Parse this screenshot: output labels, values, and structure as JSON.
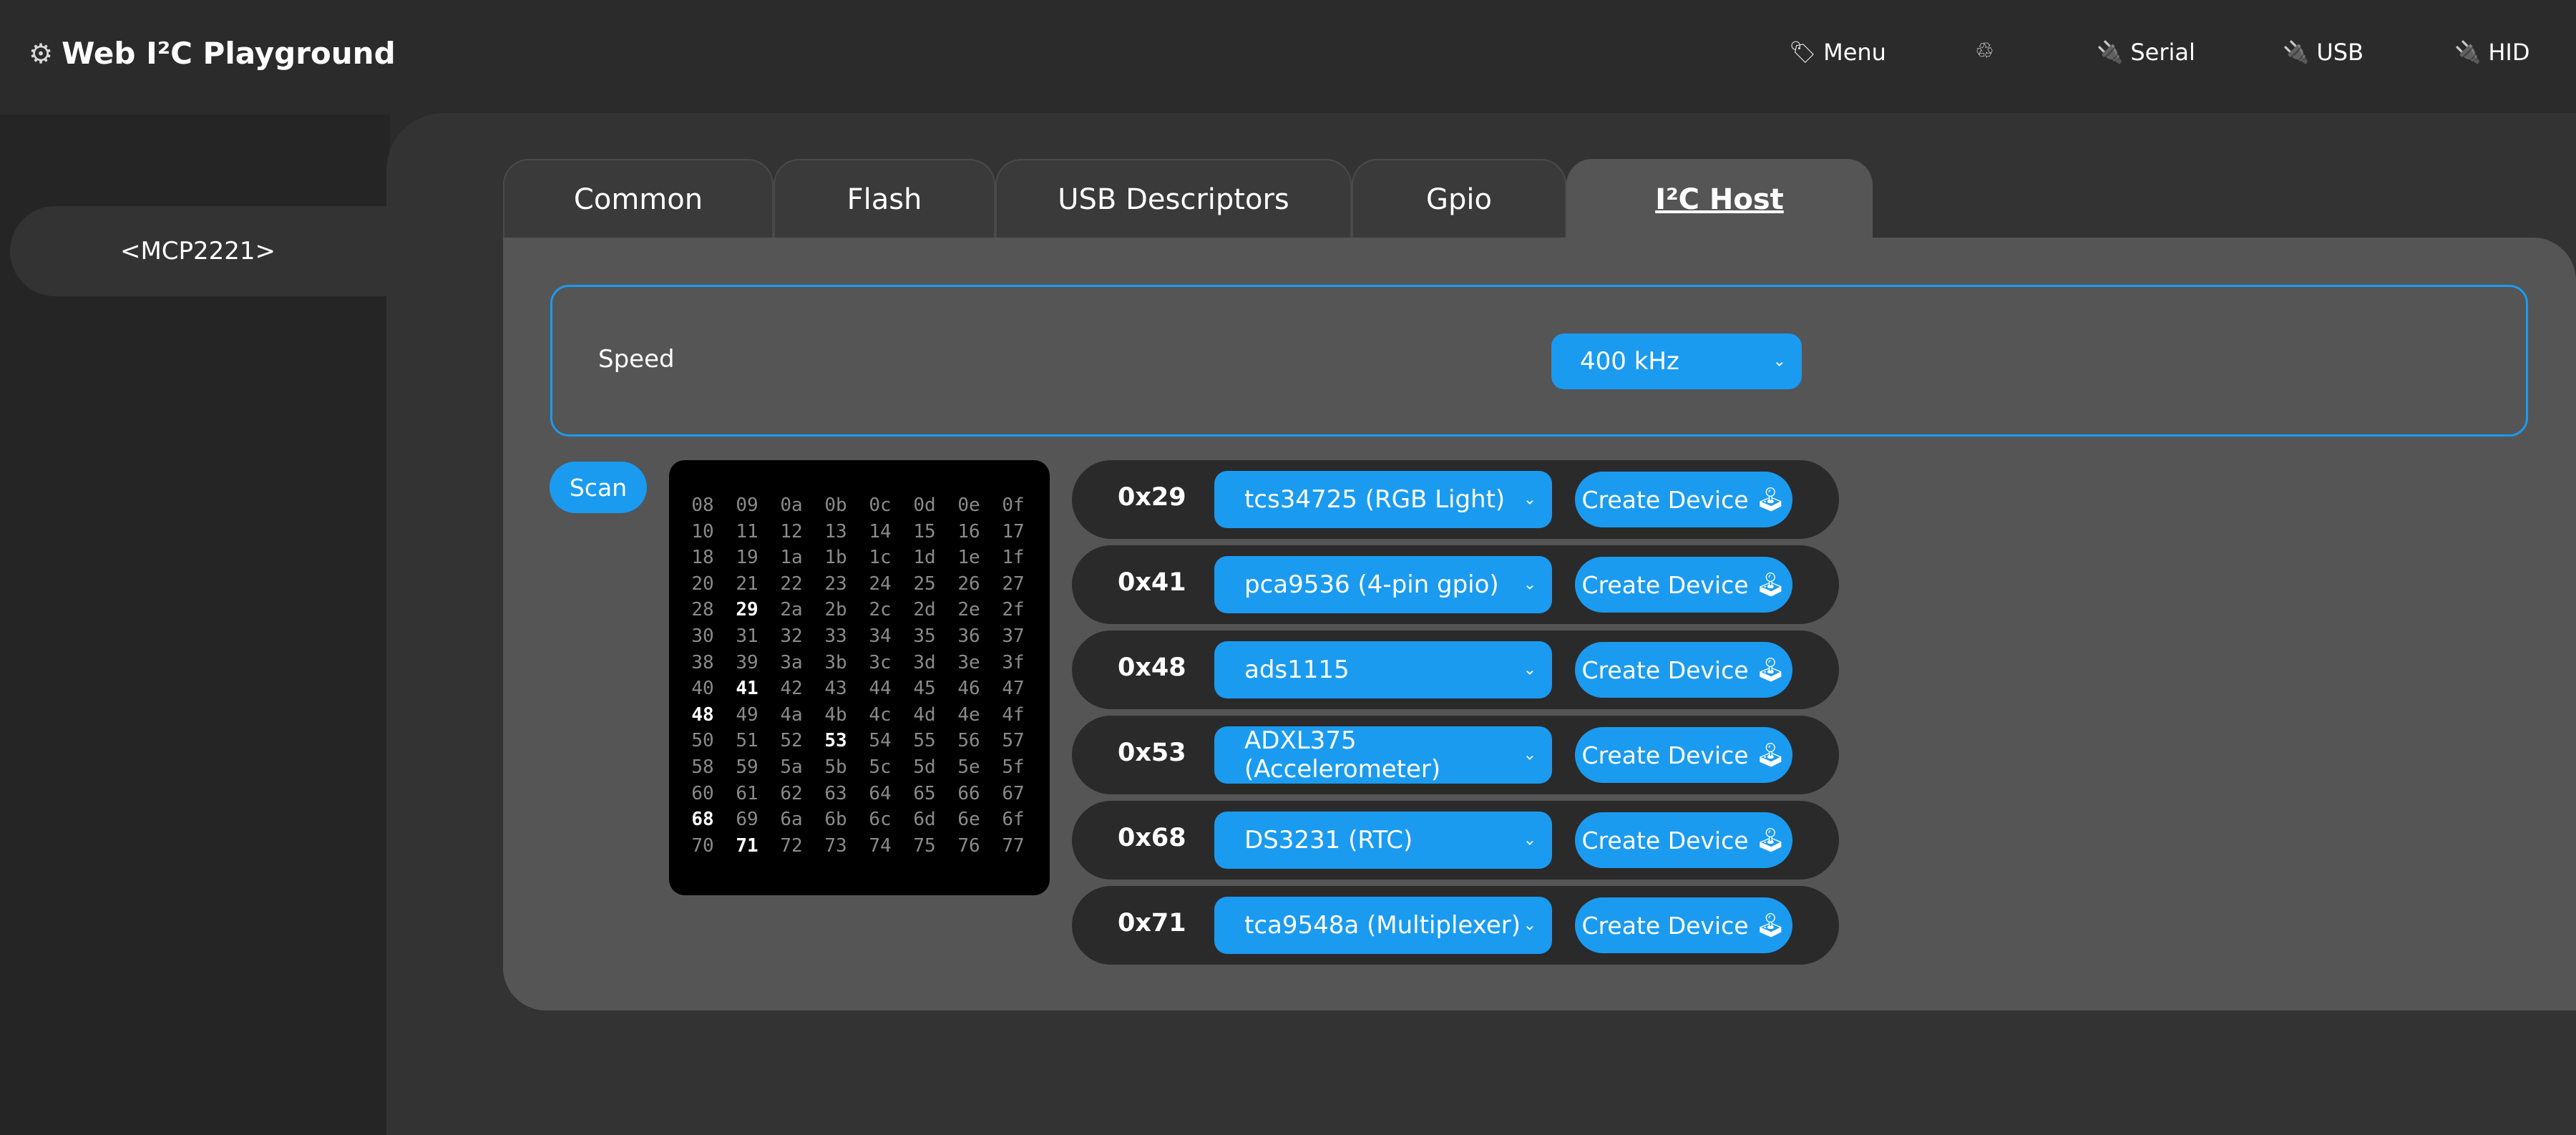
{
  "header": {
    "title": "Web I²C Playground",
    "nav": [
      {
        "icon": "tag-icon",
        "glyph": "🏷",
        "label": "Menu"
      },
      {
        "icon": "recycle-icon",
        "glyph": "♲",
        "label": ""
      },
      {
        "icon": "plug-icon",
        "glyph": "🔌",
        "label": "Serial"
      },
      {
        "icon": "plug-icon",
        "glyph": "🔌",
        "label": "USB"
      },
      {
        "icon": "plug-icon",
        "glyph": "🔌",
        "label": "HID"
      }
    ]
  },
  "sidebar": {
    "device": "<MCP2221>"
  },
  "tabs": [
    "Common",
    "Flash",
    "USB Descriptors",
    "Gpio",
    "I²C Host"
  ],
  "active_tab": "I²C Host",
  "speed": {
    "label": "Speed",
    "value": "400 kHz"
  },
  "scan_label": "Scan",
  "scan_grid": {
    "rows": [
      [
        "08",
        "09",
        "0a",
        "0b",
        "0c",
        "0d",
        "0e",
        "0f"
      ],
      [
        "10",
        "11",
        "12",
        "13",
        "14",
        "15",
        "16",
        "17"
      ],
      [
        "18",
        "19",
        "1a",
        "1b",
        "1c",
        "1d",
        "1e",
        "1f"
      ],
      [
        "20",
        "21",
        "22",
        "23",
        "24",
        "25",
        "26",
        "27"
      ],
      [
        "28",
        "29",
        "2a",
        "2b",
        "2c",
        "2d",
        "2e",
        "2f"
      ],
      [
        "30",
        "31",
        "32",
        "33",
        "34",
        "35",
        "36",
        "37"
      ],
      [
        "38",
        "39",
        "3a",
        "3b",
        "3c",
        "3d",
        "3e",
        "3f"
      ],
      [
        "40",
        "41",
        "42",
        "43",
        "44",
        "45",
        "46",
        "47"
      ],
      [
        "48",
        "49",
        "4a",
        "4b",
        "4c",
        "4d",
        "4e",
        "4f"
      ],
      [
        "50",
        "51",
        "52",
        "53",
        "54",
        "55",
        "56",
        "57"
      ],
      [
        "58",
        "59",
        "5a",
        "5b",
        "5c",
        "5d",
        "5e",
        "5f"
      ],
      [
        "60",
        "61",
        "62",
        "63",
        "64",
        "65",
        "66",
        "67"
      ],
      [
        "68",
        "69",
        "6a",
        "6b",
        "6c",
        "6d",
        "6e",
        "6f"
      ],
      [
        "70",
        "71",
        "72",
        "73",
        "74",
        "75",
        "76",
        "77"
      ]
    ],
    "found": [
      "29",
      "41",
      "48",
      "53",
      "68",
      "71"
    ]
  },
  "devices": [
    {
      "address": "0x29",
      "driver": "tcs34725 (RGB Light)",
      "button": "Create Device"
    },
    {
      "address": "0x41",
      "driver": "pca9536 (4-pin gpio)",
      "button": "Create Device"
    },
    {
      "address": "0x48",
      "driver": "ads1115",
      "button": "Create Device"
    },
    {
      "address": "0x53",
      "driver": "ADXL375 (Accelerometer)",
      "button": "Create Device"
    },
    {
      "address": "0x68",
      "driver": "DS3231 (RTC)",
      "button": "Create Device"
    },
    {
      "address": "0x71",
      "driver": "tca9548a (Multiplexer)",
      "button": "Create Device"
    }
  ],
  "colors": {
    "accent": "#1a9bf0",
    "background": "#2b2b2b",
    "panel": "#555555"
  }
}
